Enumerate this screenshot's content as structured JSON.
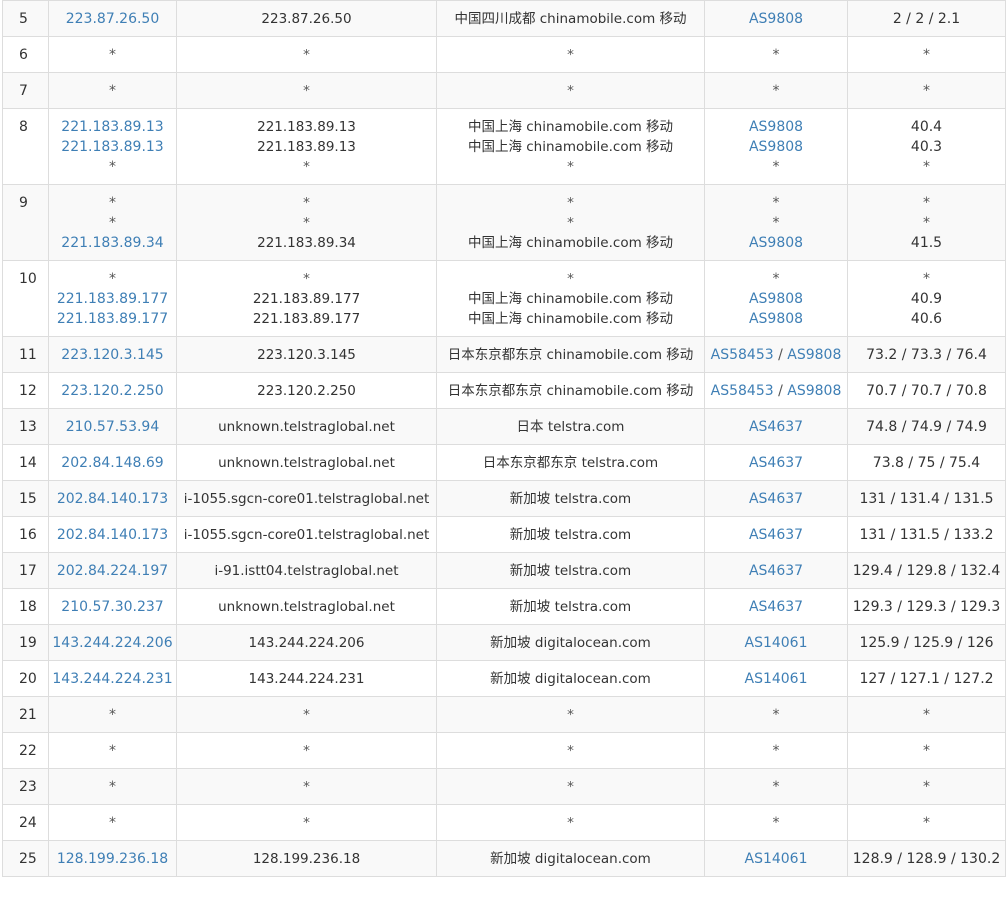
{
  "hops": [
    {
      "hop": "5",
      "lines": [
        {
          "ip": "223.87.26.50",
          "host": "223.87.26.50",
          "loc": "中国四川成都 chinamobile.com 移动",
          "as": [
            "AS9808"
          ],
          "time": "2 / 2 / 2.1"
        }
      ]
    },
    {
      "hop": "6",
      "lines": [
        {
          "ip": "*",
          "host": "*",
          "loc": "*",
          "as": [
            "*"
          ],
          "time": "*"
        }
      ]
    },
    {
      "hop": "7",
      "lines": [
        {
          "ip": "*",
          "host": "*",
          "loc": "*",
          "as": [
            "*"
          ],
          "time": "*"
        }
      ]
    },
    {
      "hop": "8",
      "lines": [
        {
          "ip": "221.183.89.13",
          "host": "221.183.89.13",
          "loc": "中国上海 chinamobile.com 移动",
          "as": [
            "AS9808"
          ],
          "time": "40.4"
        },
        {
          "ip": "221.183.89.13",
          "host": "221.183.89.13",
          "loc": "中国上海 chinamobile.com 移动",
          "as": [
            "AS9808"
          ],
          "time": "40.3"
        },
        {
          "ip": "*",
          "host": "*",
          "loc": "*",
          "as": [
            "*"
          ],
          "time": "*"
        }
      ]
    },
    {
      "hop": "9",
      "lines": [
        {
          "ip": "*",
          "host": "*",
          "loc": "*",
          "as": [
            "*"
          ],
          "time": "*"
        },
        {
          "ip": "*",
          "host": "*",
          "loc": "*",
          "as": [
            "*"
          ],
          "time": "*"
        },
        {
          "ip": "221.183.89.34",
          "host": "221.183.89.34",
          "loc": "中国上海 chinamobile.com 移动",
          "as": [
            "AS9808"
          ],
          "time": "41.5"
        }
      ]
    },
    {
      "hop": "10",
      "lines": [
        {
          "ip": "*",
          "host": "*",
          "loc": "*",
          "as": [
            "*"
          ],
          "time": "*"
        },
        {
          "ip": "221.183.89.177",
          "host": "221.183.89.177",
          "loc": "中国上海 chinamobile.com 移动",
          "as": [
            "AS9808"
          ],
          "time": "40.9"
        },
        {
          "ip": "221.183.89.177",
          "host": "221.183.89.177",
          "loc": "中国上海 chinamobile.com 移动",
          "as": [
            "AS9808"
          ],
          "time": "40.6"
        }
      ]
    },
    {
      "hop": "11",
      "lines": [
        {
          "ip": "223.120.3.145",
          "host": "223.120.3.145",
          "loc": "日本东京都东京 chinamobile.com 移动",
          "as": [
            "AS58453",
            "AS9808"
          ],
          "time": "73.2 / 73.3 / 76.4"
        }
      ]
    },
    {
      "hop": "12",
      "lines": [
        {
          "ip": "223.120.2.250",
          "host": "223.120.2.250",
          "loc": "日本东京都东京 chinamobile.com 移动",
          "as": [
            "AS58453",
            "AS9808"
          ],
          "time": "70.7 / 70.7 / 70.8"
        }
      ]
    },
    {
      "hop": "13",
      "lines": [
        {
          "ip": "210.57.53.94",
          "host": "unknown.telstraglobal.net",
          "loc": "日本 telstra.com",
          "as": [
            "AS4637"
          ],
          "time": "74.8 / 74.9 / 74.9"
        }
      ]
    },
    {
      "hop": "14",
      "lines": [
        {
          "ip": "202.84.148.69",
          "host": "unknown.telstraglobal.net",
          "loc": "日本东京都东京 telstra.com",
          "as": [
            "AS4637"
          ],
          "time": "73.8 / 75 / 75.4"
        }
      ]
    },
    {
      "hop": "15",
      "lines": [
        {
          "ip": "202.84.140.173",
          "host": "i-1055.sgcn-core01.telstraglobal.net",
          "loc": "新加坡 telstra.com",
          "as": [
            "AS4637"
          ],
          "time": "131 / 131.4 / 131.5"
        }
      ]
    },
    {
      "hop": "16",
      "lines": [
        {
          "ip": "202.84.140.173",
          "host": "i-1055.sgcn-core01.telstraglobal.net",
          "loc": "新加坡 telstra.com",
          "as": [
            "AS4637"
          ],
          "time": "131 / 131.5 / 133.2"
        }
      ]
    },
    {
      "hop": "17",
      "lines": [
        {
          "ip": "202.84.224.197",
          "host": "i-91.istt04.telstraglobal.net",
          "loc": "新加坡 telstra.com",
          "as": [
            "AS4637"
          ],
          "time": "129.4 / 129.8 / 132.4"
        }
      ]
    },
    {
      "hop": "18",
      "lines": [
        {
          "ip": "210.57.30.237",
          "host": "unknown.telstraglobal.net",
          "loc": "新加坡 telstra.com",
          "as": [
            "AS4637"
          ],
          "time": "129.3 / 129.3 / 129.3"
        }
      ]
    },
    {
      "hop": "19",
      "lines": [
        {
          "ip": "143.244.224.206",
          "host": "143.244.224.206",
          "loc": "新加坡 digitalocean.com",
          "as": [
            "AS14061"
          ],
          "time": "125.9 / 125.9 / 126"
        }
      ]
    },
    {
      "hop": "20",
      "lines": [
        {
          "ip": "143.244.224.231",
          "host": "143.244.224.231",
          "loc": "新加坡 digitalocean.com",
          "as": [
            "AS14061"
          ],
          "time": "127 / 127.1 / 127.2"
        }
      ]
    },
    {
      "hop": "21",
      "lines": [
        {
          "ip": "*",
          "host": "*",
          "loc": "*",
          "as": [
            "*"
          ],
          "time": "*"
        }
      ]
    },
    {
      "hop": "22",
      "lines": [
        {
          "ip": "*",
          "host": "*",
          "loc": "*",
          "as": [
            "*"
          ],
          "time": "*"
        }
      ]
    },
    {
      "hop": "23",
      "lines": [
        {
          "ip": "*",
          "host": "*",
          "loc": "*",
          "as": [
            "*"
          ],
          "time": "*"
        }
      ]
    },
    {
      "hop": "24",
      "lines": [
        {
          "ip": "*",
          "host": "*",
          "loc": "*",
          "as": [
            "*"
          ],
          "time": "*"
        }
      ]
    },
    {
      "hop": "25",
      "lines": [
        {
          "ip": "128.199.236.18",
          "host": "128.199.236.18",
          "loc": "新加坡 digitalocean.com",
          "as": [
            "AS14061"
          ],
          "time": "128.9 / 128.9 / 130.2"
        }
      ]
    }
  ],
  "as_separator": "/",
  "colors": {
    "link": "#3f7fb5",
    "row_odd": "#f9f9f9",
    "row_even": "#ffffff",
    "border": "#dddddd",
    "text": "#333333"
  }
}
